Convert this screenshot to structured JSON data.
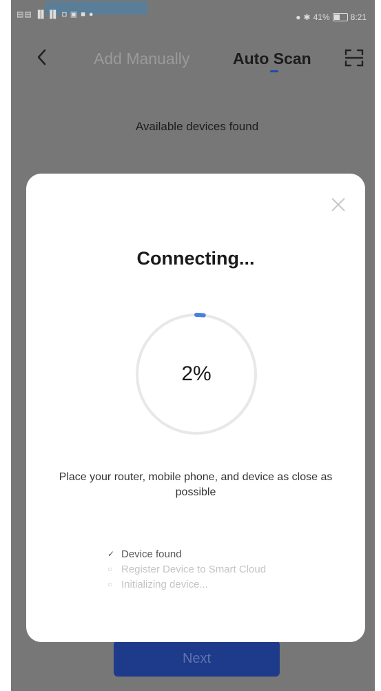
{
  "status_bar": {
    "left_text": "▤▤ ▐▌▐▌ ◘ ▣ ■ ●",
    "battery_percent": "41%",
    "time": "8:21",
    "icons": [
      "alarm-icon",
      "bluetooth-icon",
      "battery-icon"
    ]
  },
  "header": {
    "tabs": [
      {
        "label": "Add Manually",
        "active": false
      },
      {
        "label": "Auto Scan",
        "active": true
      }
    ],
    "back_icon": "chevron-left-icon",
    "scan_icon": "scan-frame-icon"
  },
  "main": {
    "available_text": "Available devices found",
    "next_label": "Next"
  },
  "modal": {
    "title": "Connecting...",
    "progress_label": "2%",
    "progress_fraction": 0.02,
    "hint": "Place your router, mobile phone, and device as close as possible",
    "steps": [
      {
        "label": "Device found",
        "state": "done",
        "icon": "✓"
      },
      {
        "label": "Register Device to Smart Cloud",
        "state": "pending",
        "icon": "○"
      },
      {
        "label": "Initializing device...",
        "state": "pending",
        "icon": "○"
      }
    ],
    "close_icon": "close-icon"
  },
  "colors": {
    "overlay": "#777777",
    "accent": "#4a7fe0",
    "next_button": "#1e3a8a",
    "ring_track": "#e8e8e8"
  }
}
